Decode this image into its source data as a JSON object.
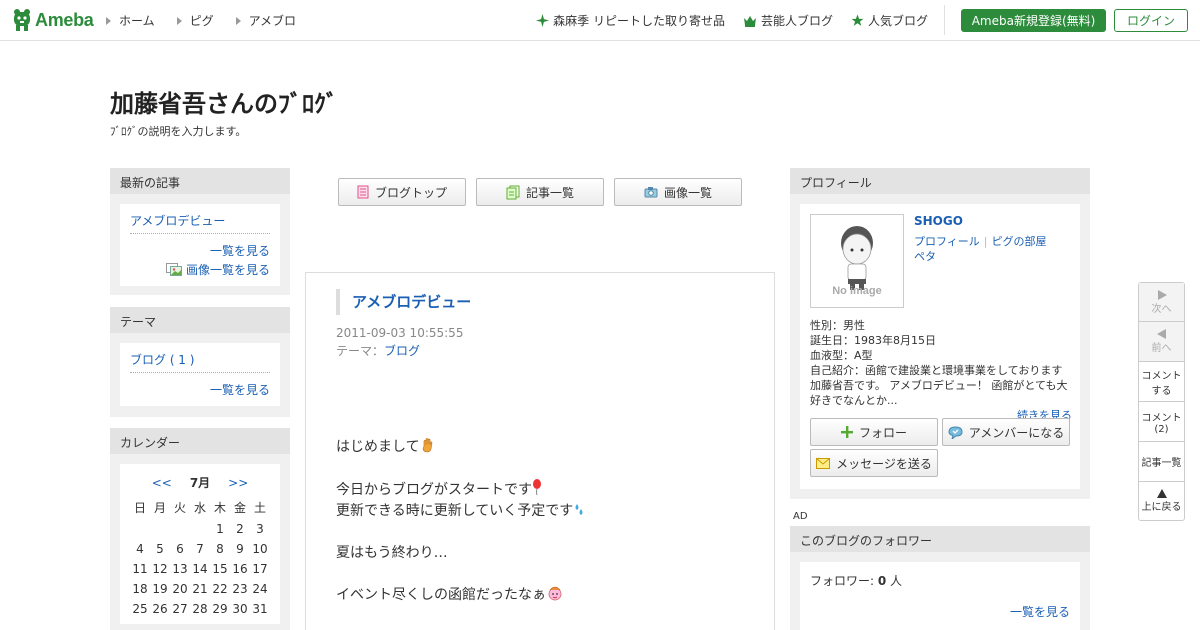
{
  "header": {
    "logo_text": "Ameba",
    "nav_left": [
      "ホーム",
      "ピグ",
      "アメブロ"
    ],
    "nav_right": [
      {
        "label": "森麻季 リピートした取り寄せ品",
        "icon": "sparkle-icon"
      },
      {
        "label": "芸能人ブログ",
        "icon": "crown-icon"
      },
      {
        "label": "人気ブログ",
        "icon": "star-icon"
      }
    ],
    "register_label": "Ameba新規登録(無料)",
    "login_label": "ログイン",
    "accent_color": "#2d8c3c"
  },
  "blog": {
    "title": "加藤省吾さんのﾌﾞﾛｸﾞ",
    "description": "ﾌﾞﾛｸﾞの説明を入力します。"
  },
  "sidebar": {
    "recent": {
      "heading": "最新の記事",
      "items": [
        "アメブロデビュー"
      ],
      "list_link": "一覧を見る",
      "image_list_link": "画像一覧を見る"
    },
    "theme": {
      "heading": "テーマ",
      "items": [
        "ブログ ( 1 )"
      ],
      "list_link": "一覧を見る"
    },
    "calendar": {
      "heading": "カレンダー",
      "prev": "<<",
      "month": "7月",
      "next": ">>",
      "weekdays": [
        "日",
        "月",
        "火",
        "水",
        "木",
        "金",
        "土"
      ],
      "days": [
        "",
        "",
        "",
        "",
        "1",
        "2",
        "3",
        "4",
        "5",
        "6",
        "7",
        "8",
        "9",
        "10",
        "11",
        "12",
        "13",
        "14",
        "15",
        "16",
        "17",
        "18",
        "19",
        "20",
        "21",
        "22",
        "23",
        "24",
        "25",
        "26",
        "27",
        "28",
        "29",
        "30",
        "31"
      ]
    }
  },
  "tabs": {
    "blog_top": "ブログトップ",
    "articles": "記事一覧",
    "images": "画像一覧"
  },
  "article": {
    "title": "アメブロデビュー",
    "date": "2011-09-03 10:55:55",
    "theme_label": "テーマ：",
    "theme": "ブログ",
    "body": {
      "l1": "はじめまして",
      "l2": "今日からブログがスタートです",
      "l3": "更新できる時に更新していく予定です",
      "l4": "夏はもう終わり…",
      "l5": "イベント尽くしの函館だったなぁ"
    }
  },
  "profile": {
    "heading": "プロフィール",
    "image_alt": "No image",
    "name": "SHOGO",
    "links": [
      "プロフィール",
      "ピグの部屋",
      "ペタ"
    ],
    "gender": "性別：男性",
    "birthday": "誕生日：1983年8月15日",
    "blood": "血液型：A型",
    "intro": "自己紹介：函館で建設業と環境事業をしております加藤省吾です。 アメブロデビュー！ 函館がとても大好きでなんとか...",
    "more": "続きを見る",
    "follow": "フォロー",
    "amember": "アメンバーになる",
    "message": "メッセージを送る"
  },
  "ad_label": "AD",
  "followers": {
    "heading": "このブログのフォロワー",
    "label": "フォロワー: ",
    "count": "0",
    "unit": " 人",
    "list_link": "一覧を見る"
  },
  "float_nav": {
    "next": "次へ",
    "prev": "前へ",
    "comment1": "コメント",
    "comment2": "する",
    "comments1": "コメント",
    "comments2": "(2)",
    "articles": "記事一覧",
    "top": "上に戻る"
  }
}
